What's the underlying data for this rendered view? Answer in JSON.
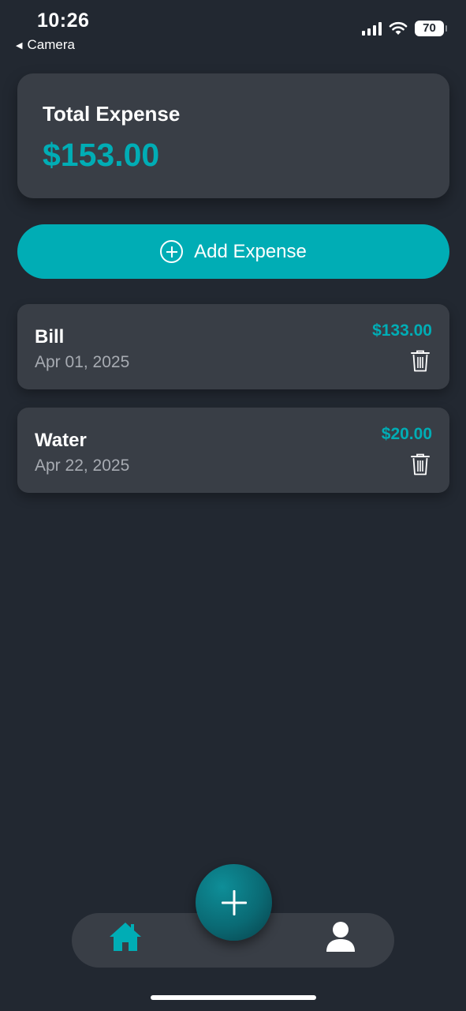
{
  "status_bar": {
    "time": "10:26",
    "back_label": "Camera",
    "battery": "70"
  },
  "summary": {
    "title": "Total Expense",
    "amount": "$153.00"
  },
  "actions": {
    "add_expense_label": "Add Expense"
  },
  "expenses": [
    {
      "name": "Bill",
      "date": "Apr 01, 2025",
      "amount": "$133.00"
    },
    {
      "name": "Water",
      "date": "Apr 22, 2025",
      "amount": "$20.00"
    }
  ],
  "bottom_nav": {
    "items": [
      {
        "icon": "home-icon",
        "active": true
      },
      {
        "icon": "add-icon",
        "active": false
      },
      {
        "icon": "user-icon",
        "active": false
      }
    ]
  },
  "colors": {
    "background": "#222831",
    "card": "#393e46",
    "accent": "#00adb5",
    "text": "#ffffff",
    "muted": "#a7abb2"
  }
}
